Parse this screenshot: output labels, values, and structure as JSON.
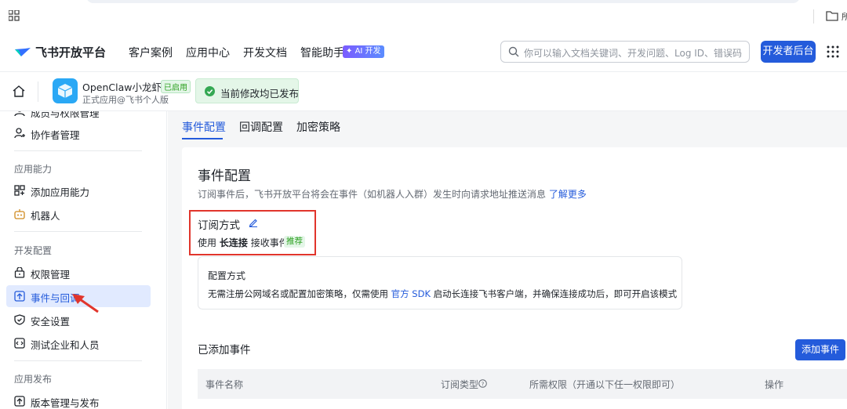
{
  "header": {
    "brand": "飞书开放平台",
    "nav": [
      "客户案例",
      "应用中心",
      "开发文档",
      "智能助手"
    ],
    "ai_badge": "AI 开发",
    "search_placeholder": "你可以输入文档关键词、开发问题、Log ID、错误码",
    "console_button": "开发者后台"
  },
  "app": {
    "name": "OpenClaw小龙虾虾",
    "status_badge": "已启用",
    "subtitle": "正式应用@飞书个人版",
    "toast": "当前修改均已发布"
  },
  "sidebar": {
    "top_items": [
      {
        "label": "成员与权限管理",
        "icon": "member-icon"
      },
      {
        "label": "协作者管理",
        "icon": "user-icon"
      }
    ],
    "sections": [
      {
        "title": "应用能力",
        "items": [
          {
            "label": "添加应用能力",
            "icon": "grid-icon"
          },
          {
            "label": "机器人",
            "icon": "robot-icon"
          }
        ]
      },
      {
        "title": "开发配置",
        "items": [
          {
            "label": "权限管理",
            "icon": "lock-icon"
          },
          {
            "label": "事件与回调",
            "icon": "event-icon",
            "active": true
          },
          {
            "label": "安全设置",
            "icon": "shield-icon"
          },
          {
            "label": "测试企业和人员",
            "icon": "code-icon"
          }
        ]
      },
      {
        "title": "应用发布",
        "items": [
          {
            "label": "版本管理与发布",
            "icon": "version-icon"
          }
        ]
      }
    ]
  },
  "tabs": [
    "事件配置",
    "回调配置",
    "加密策略"
  ],
  "event_config": {
    "title": "事件配置",
    "description": "订阅事件后，飞书开放平台将会在事件（如机器人入群）发生时向请求地址推送消息",
    "learn_more": "了解更多",
    "subscribe_label": "订阅方式",
    "mode_prefix": "使用",
    "mode_bold": "长连接",
    "mode_suffix": "接收事件",
    "recommend_badge": "推荐",
    "mode_card_title": "配置方式",
    "mode_card_text_a": "无需注册公网域名或配置加密策略，仅需使用",
    "mode_card_link": "官方 SDK",
    "mode_card_text_b": "启动长连接飞书客户端，并确保连接成功后，即可开启该模式",
    "added_events_title": "已添加事件",
    "add_event_button": "添加事件",
    "table_headers": [
      "事件名称",
      "订阅类型",
      "所需权限（开通以下任一权限即可）",
      "操作"
    ]
  },
  "colors": {
    "accent": "#245bdb",
    "highlight": "#e1352c",
    "success": "#34a853"
  }
}
